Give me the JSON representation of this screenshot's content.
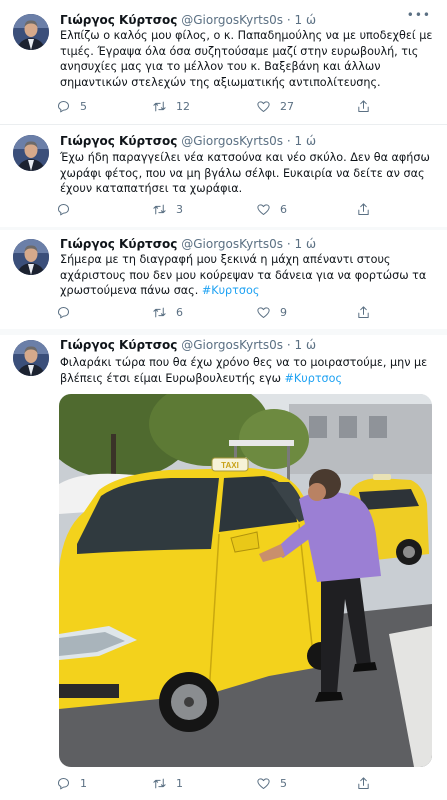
{
  "tweets": [
    {
      "name": "Γιώργος Κύρτσος",
      "handle": "@GiorgosKyrts0s",
      "dot": "·",
      "time": "1 ώ",
      "text": "Ελπίζω ο καλός μου φίλος, ο κ. Παπαδημούλης να με υποδεχθεί με τιμές. Έγραψα όλα όσα συζητούσαμε μαζί στην ευρωβουλή, τις ανησυχίες μας για το μέλλον του κ. Βαξεβάνη και άλλων σημαντικών στελεχών της αξιωματικής αντιπολίτευσης.",
      "hashtag": "",
      "replies": "5",
      "retweets": "12",
      "likes": "27"
    },
    {
      "name": "Γιώργος Κύρτσος",
      "handle": "@GiorgosKyrts0s",
      "dot": "·",
      "time": "1 ώ",
      "text": "Έχω ήδη παραγγείλει νέα κατσούνα και νέο σκύλο. Δεν θα αφήσω χωράφι φέτος, που να μη βγάλω σέλφι. Ευκαιρία να δείτε αν σας έχουν καταπατήσει τα χωράφια.",
      "hashtag": "",
      "replies": "",
      "retweets": "3",
      "likes": "6"
    },
    {
      "name": "Γιώργος Κύρτσος",
      "handle": "@GiorgosKyrts0s",
      "dot": "·",
      "time": "1 ώ",
      "text": "Σήμερα με τη διαγραφή μου ξεκινά η μάχη απέναντι στους αχάριστους που δεν μου κούρεψαν τα δάνεια για να φορτώσω τα χρωστούμενα πάνω σας. ",
      "hashtag": "#Κυρτσος",
      "replies": "",
      "retweets": "6",
      "likes": "9"
    },
    {
      "name": "Γιώργος Κύρτσος",
      "handle": "@GiorgosKyrts0s",
      "dot": "·",
      "time": "1 ώ",
      "text": "Φιλαράκι τώρα που θα έχω χρόνο θες να το μοιραστούμε, μην με βλέπεις έτσι είμαι Ευρωβουλευτής εγω  ",
      "hashtag": "#Κυρτσος",
      "replies": "1",
      "retweets": "1",
      "likes": "5"
    }
  ],
  "photo": {
    "taxi_sign": "TAXI"
  },
  "colors": {
    "accent": "#1da1f2",
    "secondary_text": "#5b7083",
    "taxi_yellow": "#f3d21c",
    "shirt_purple": "#9b7fd4"
  }
}
